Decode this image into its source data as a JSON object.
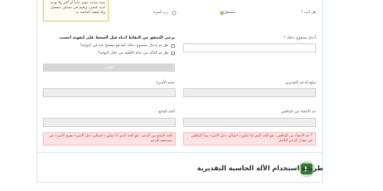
{
  "note": {
    "text": "سنة ثمانية عشر عاماً أو أكثر ولا يوجد لديه تابعين، ويقيم في مسكن منفصل وله نفقته الخاصة به"
  },
  "question": {
    "label": "هل أنت ؟",
    "options": [
      "مستقل",
      "رب أسرة"
    ],
    "selected": "مستقل"
  },
  "total_income": {
    "label": "أدخل مجموع دخلك *",
    "value": ""
  },
  "verify": {
    "heading": "يرجى التحقق من النقاط أدناه قبل الضغط على أيقونة احسب",
    "check1": "هل تم إدخال مجموع دخلك كما هو مفصح عنه في البوابة؟",
    "check2": "هل تم التأكد من حالة الأهلية من خلال البوابة؟"
  },
  "calc_button": {
    "label": "احسب"
  },
  "estimated_support": {
    "label": "مبلغ الدعم التقديري",
    "value": ""
  },
  "family_size": {
    "label": "حجم الأسرة",
    "value": ""
  },
  "exempt_limit": {
    "label": "حد الاعفاء من التناقص",
    "value": "",
    "note": "* حد الاعفاء من التناقص : هو الحد الذي إذا تجاوزه اجمالي دخل الاسرة يبدأ التناقص في مقدار الدعم الكامل"
  },
  "prevent_limit": {
    "label": "الحد المانع :",
    "value": "",
    "note": "الحد المانع من الدعم : هو الحد الذي اذا تجاوزه اجمالي دخل الاسرة تصبح الأسرة غير مستحقة للدعم"
  },
  "howto": {
    "title": "طريقة استخدام الألة الحاسبة التقديرية"
  }
}
